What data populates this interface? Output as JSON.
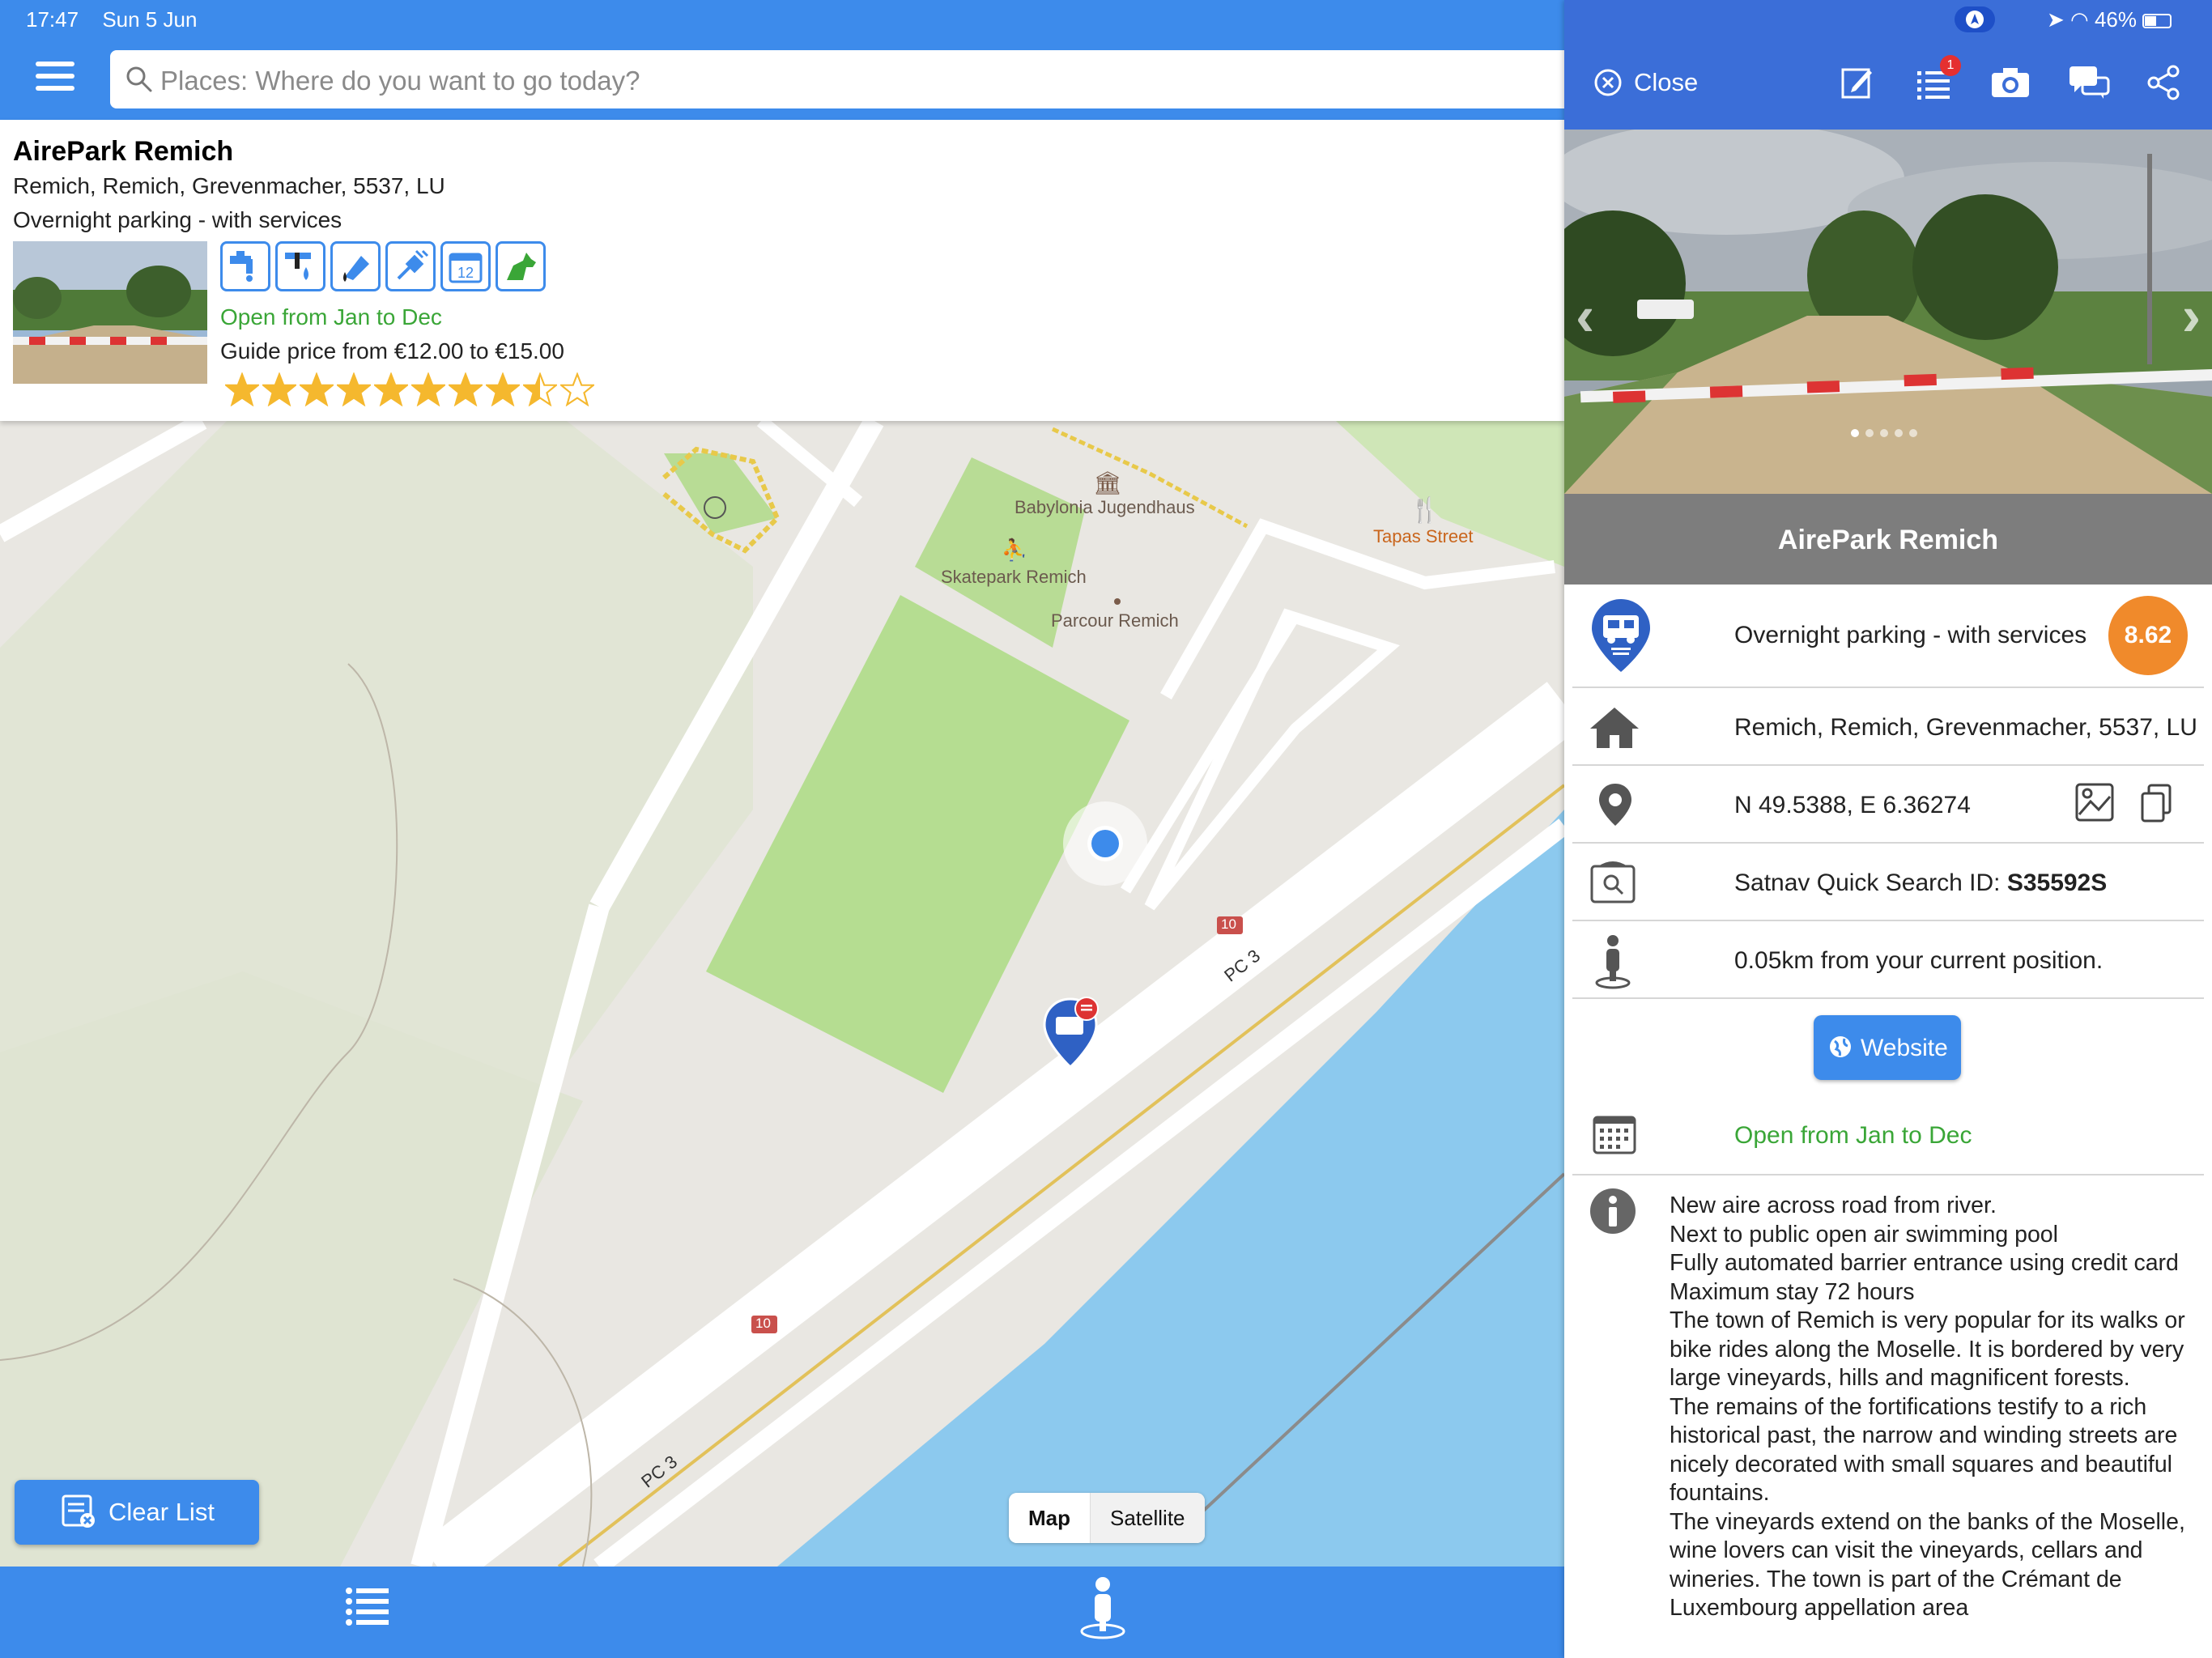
{
  "status_bar": {
    "time": "17:47",
    "date": "Sun 5 Jun",
    "battery": "46%"
  },
  "search": {
    "placeholder": "Places: Where do you want to go today?"
  },
  "info_card": {
    "name": "AirePark Remich",
    "address": "Remich, Remich, Grevenmacher, 5537, LU",
    "category": "Overnight parking - with services",
    "open_months": "Open from Jan to Dec",
    "guide_price": "Guide price from €12.00 to €15.00",
    "rating": 8.5,
    "rating_max": 10,
    "amenity_icons": [
      "water-tap-icon",
      "grey-water-icon",
      "black-water-icon",
      "electricity-icon",
      "calendar-icon",
      "dog-icon"
    ]
  },
  "map": {
    "labels": {
      "babylonia": "Babylonia Jugendhaus",
      "skatepark": "Skatepark Remich",
      "parcour": "Parcour Remich",
      "tapas": "Tapas Street",
      "road_pc3_a": "PC 3",
      "road_pc3_b": "PC 3",
      "road_10_a": "10",
      "road_10_b": "10"
    },
    "buttons": {
      "clear_list": "Clear List",
      "map": "Map",
      "satellite": "Satellite",
      "selected_maptype": "Map"
    }
  },
  "detail": {
    "close_label": "Close",
    "list_badge": "1",
    "title": "AirePark Remich",
    "photo_count": 5,
    "photo_index": 1,
    "category": "Overnight parking - with services",
    "score": "8.62",
    "address": "Remich, Remich, Grevenmacher, 5537, LU",
    "coordinates": "N 49.5388, E 6.36274",
    "satnav_label": "Satnav Quick Search ID: ",
    "satnav_id": "S35592S",
    "distance": "0.05km from your current position.",
    "website_label": "Website",
    "open_months": "Open from Jan to Dec",
    "description": [
      "New aire across road from river.",
      "Next to public open air swimming pool",
      "Fully automated barrier entrance using credit card",
      "Maximum stay 72 hours",
      "The town of Remich is very popular for its walks or bike rides along the Moselle. It is bordered by very large vineyards, hills and magnificent forests.",
      "The remains of the fortifications testify to a rich historical past, the narrow and winding streets are nicely decorated with small squares and beautiful fountains.",
      "The vineyards extend on the banks of the Moselle, wine lovers can visit the vineyards, cellars and wineries. The town is part of the Crémant de Luxembourg appellation area"
    ]
  },
  "colors": {
    "brand_blue": "#3d8beb",
    "header_blue": "#3b6ed8",
    "open_green": "#3aa637",
    "score_orange": "#f08a2b",
    "star_gold": "#f5b82e"
  }
}
